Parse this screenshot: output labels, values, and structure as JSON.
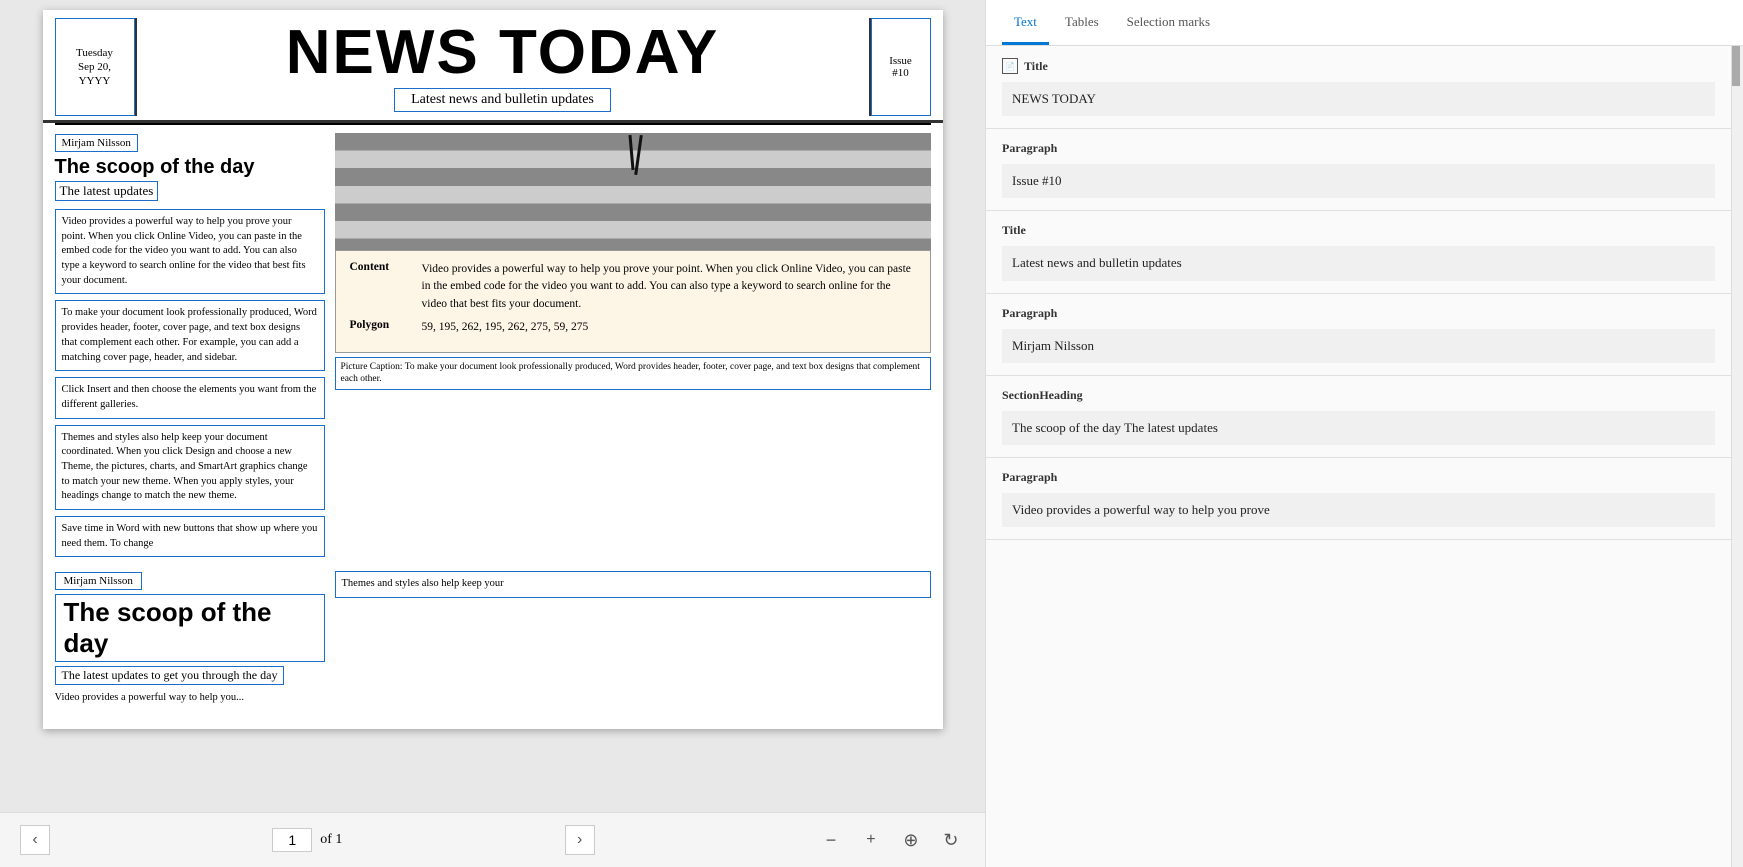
{
  "doc": {
    "header": {
      "date": "Tuesday\nSep 20,\nYYYY",
      "title": "NEWS TODAY",
      "subtitle": "Latest news and bulletin updates",
      "issue": "Issue\n#10"
    },
    "section1": {
      "author": "Mirjam Nilsson",
      "heading": "The scoop of the day",
      "subheading": "The latest updates",
      "text1": "Video provides a powerful way to help you prove your point. When you click Online Video, you can paste in the embed code for the video you want to add. You can also type a keyword to search online for the video that best fits your document.",
      "text2": "To make your document look professionally produced, Word provides header, footer, cover page, and text box designs that complement each other. For example, you can add a matching cover page, header, and sidebar.",
      "text3": "Click Insert and then choose the elements you want from the different galleries.",
      "text4": "Themes and styles also help keep your document coordinated. When you click Design and choose a new Theme, the pictures, charts, and SmartArt graphics change to match your new theme. When you apply styles, your headings change to match the new theme.",
      "text5": "Save time in Word with new buttons that show up where you need them. To change"
    },
    "tooltip": {
      "content_label": "Content",
      "content_value": "Video provides a powerful way to help you prove your point. When you click Online Video, you can paste in the embed code for the video you want to add. You can also type a keyword to search online for the video that best fits your document.",
      "polygon_label": "Polygon",
      "polygon_value": "59, 195, 262, 195, 262, 275, 59, 275"
    },
    "caption": "Picture Caption: To make your document look professionally produced, Word provides header, footer, cover page, and text box designs that complement each other.",
    "section2": {
      "author": "Mirjam Nilsson",
      "heading": "The scoop of the day",
      "subheading": "The latest updates to get you through the day",
      "text_partial": "Video provides a powerful way to help you..."
    },
    "bottom_right_partial": "Themes and styles also help keep your"
  },
  "pagination": {
    "current_page": "1",
    "of_label": "of 1"
  },
  "right_panel": {
    "tabs": [
      {
        "label": "Text",
        "active": true
      },
      {
        "label": "Tables",
        "active": false
      },
      {
        "label": "Selection marks",
        "active": false
      }
    ],
    "results": [
      {
        "type": "Title",
        "value": "NEWS TODAY"
      },
      {
        "type": "Paragraph",
        "value": "Issue #10"
      },
      {
        "type": "Title",
        "value": "Latest news and bulletin updates"
      },
      {
        "type": "Paragraph",
        "value": "Mirjam Nilsson"
      },
      {
        "type": "SectionHeading",
        "value": "The scoop of the day The latest updates"
      },
      {
        "type": "Paragraph",
        "value": "Video provides a powerful way to help you prove"
      }
    ]
  }
}
